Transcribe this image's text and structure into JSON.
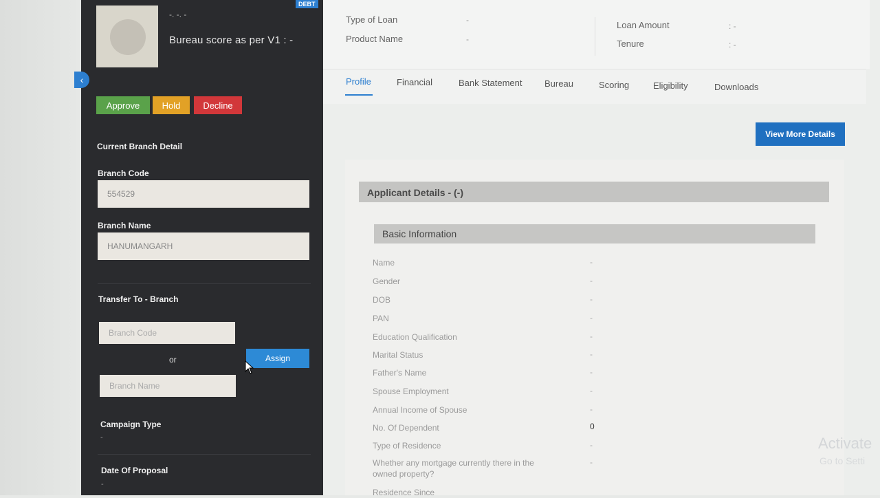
{
  "sidebar": {
    "customer_name": "-. -. -",
    "bureau_score": "Bureau score as per V1 : -",
    "badge": "DEBT",
    "collapse_icon": "chevron-left-icon",
    "actions": {
      "approve": "Approve",
      "hold": "Hold",
      "decline": "Decline"
    },
    "current_branch_title": "Current Branch Detail",
    "branch_code_label": "Branch Code",
    "branch_code_value": "554529",
    "branch_name_label": "Branch Name",
    "branch_name_value": "HANUMANGARH",
    "transfer_title": "Transfer To - Branch",
    "transfer_code_placeholder": "Branch Code",
    "or_text": "or",
    "transfer_name_placeholder": "Branch Name",
    "assign_label": "Assign",
    "campaign_label": "Campaign Type",
    "campaign_value": "-",
    "date_label": "Date Of Proposal",
    "date_value": "-"
  },
  "header": {
    "type_of_loan_label": "Type of Loan",
    "type_of_loan_value": "-",
    "product_name_label": "Product Name",
    "product_name_value": "-",
    "loan_amount_label": "Loan Amount",
    "loan_amount_value": ": -",
    "tenure_label": "Tenure",
    "tenure_value": ": -"
  },
  "tabs": [
    "Profile",
    "Financial",
    "Bank Statement",
    "Bureau",
    "Scoring",
    "Eligibility",
    "Downloads"
  ],
  "view_more_label": "View More Details",
  "applicant": {
    "title": "Applicant Details - (-)",
    "basic_title": "Basic Information",
    "rows": [
      {
        "label": "Name",
        "value": "-"
      },
      {
        "label": "Gender",
        "value": "-"
      },
      {
        "label": "DOB",
        "value": "-"
      },
      {
        "label": "PAN",
        "value": "-"
      },
      {
        "label": "Education Qualification",
        "value": "-"
      },
      {
        "label": "Marital Status",
        "value": "-"
      },
      {
        "label": "Father's Name",
        "value": "-"
      },
      {
        "label": "Spouse Employment",
        "value": "-"
      },
      {
        "label": "Annual Income of Spouse",
        "value": "-"
      },
      {
        "label": "No. Of Dependent",
        "value": "0"
      },
      {
        "label": "Type of Residence",
        "value": "-"
      },
      {
        "label": "Whether any mortgage currently there in the owned property?",
        "value": "-"
      },
      {
        "label": "Residence Since",
        "value": ""
      }
    ]
  },
  "watermark": {
    "line1": "Activate",
    "line2": "Go to Setti"
  },
  "colors": {
    "primary": "#2d7fd0",
    "approve": "#5aa24a",
    "hold": "#e2a126",
    "decline": "#d2373a",
    "sidebar_bg": "#2a2b2e"
  }
}
